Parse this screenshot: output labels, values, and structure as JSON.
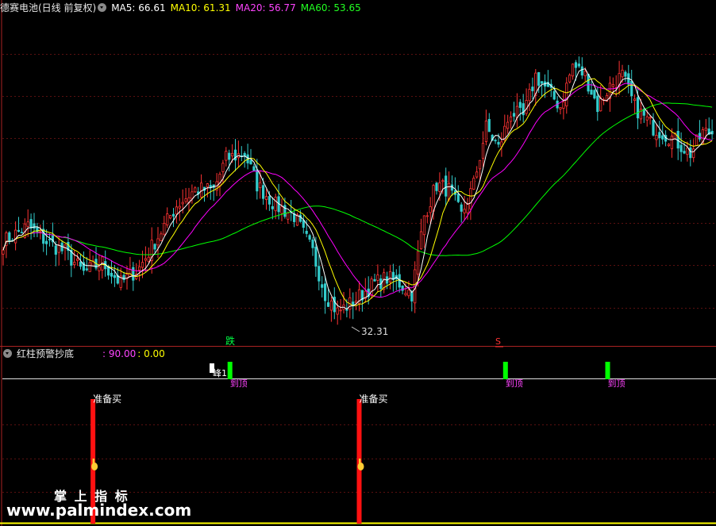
{
  "header_main": {
    "title": "德赛电池(日线 前复权)",
    "ma5": "MA5: 66.61",
    "ma10": "MA10: 61.31",
    "ma20": "MA20: 56.77",
    "ma60": "MA60: 53.65"
  },
  "header_sub": {
    "title": "红柱预警抄底",
    "v1": ": 90.00",
    "v2": ": 0.00"
  },
  "annotations": {
    "low_price": "32.31",
    "die_label": "跌",
    "sell_label": "S",
    "feng_label": "峰1",
    "daoding": "到顶",
    "zhunbeimai": "准备买"
  },
  "watermark": {
    "line1": "掌 上 指 标",
    "line2": "www.palmindex.com"
  },
  "colors": {
    "ma5": "#ffffff",
    "ma10": "#ffff00",
    "ma20": "#ff00ff",
    "ma60": "#00ff00",
    "up": "#ff3333",
    "down": "#33cccc",
    "grid": "#5a1010",
    "border": "#aa2222"
  },
  "chart_data": [
    {
      "type": "line",
      "title": "德赛电池(日线 前复权)",
      "series": [
        {
          "name": "MA5",
          "last": 66.61
        },
        {
          "name": "MA10",
          "last": 61.31
        },
        {
          "name": "MA20",
          "last": 56.77
        },
        {
          "name": "MA60",
          "last": 53.65
        }
      ],
      "min_label": 32.31,
      "keypoints": [
        [
          0,
          46
        ],
        [
          8,
          49
        ],
        [
          14,
          46
        ],
        [
          20,
          44
        ],
        [
          26,
          40
        ],
        [
          32,
          42
        ],
        [
          38,
          38
        ],
        [
          44,
          41
        ],
        [
          50,
          47
        ],
        [
          56,
          53
        ],
        [
          62,
          56
        ],
        [
          68,
          56
        ],
        [
          72,
          62
        ],
        [
          78,
          63
        ],
        [
          82,
          57
        ],
        [
          88,
          53
        ],
        [
          94,
          51
        ],
        [
          100,
          44
        ],
        [
          104,
          36
        ],
        [
          108,
          32.5
        ],
        [
          112,
          34
        ],
        [
          116,
          36
        ],
        [
          120,
          38
        ],
        [
          124,
          39
        ],
        [
          128,
          38
        ],
        [
          132,
          36
        ],
        [
          136,
          51
        ],
        [
          140,
          57
        ],
        [
          144,
          56
        ],
        [
          148,
          51
        ],
        [
          152,
          57
        ],
        [
          156,
          68
        ],
        [
          160,
          64
        ],
        [
          164,
          71
        ],
        [
          168,
          70
        ],
        [
          172,
          78
        ],
        [
          176,
          75
        ],
        [
          180,
          72
        ],
        [
          184,
          80
        ],
        [
          188,
          78
        ],
        [
          192,
          72
        ],
        [
          196,
          76
        ],
        [
          200,
          78
        ],
        [
          204,
          72
        ],
        [
          210,
          68
        ],
        [
          216,
          66
        ],
        [
          222,
          63
        ],
        [
          226,
          67
        ]
      ],
      "ylim": [
        29,
        91
      ]
    },
    {
      "type": "bar",
      "title": "红柱预警抄底",
      "values": [
        90.0,
        0.0
      ],
      "buy_signals": [
        29,
        115
      ],
      "top_signals": [
        73,
        162,
        195
      ],
      "ylim": [
        0,
        100
      ]
    }
  ]
}
